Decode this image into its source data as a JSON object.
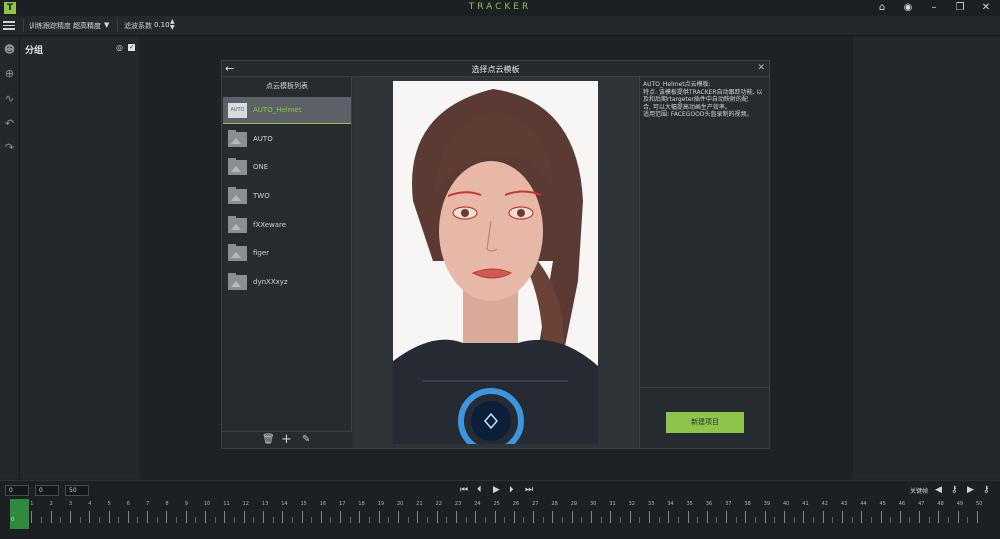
{
  "app": {
    "logo": "T",
    "title": "TRACKER",
    "window_buttons": [
      "home-icon",
      "user-icon",
      "minimize-icon",
      "maximize-icon",
      "close-icon"
    ]
  },
  "toolbar": {
    "precision_label": "训练跟踪精度",
    "precision_value": "超高精度",
    "filter_label": "滤波系数",
    "filter_value": "0.10"
  },
  "left_tools": [
    "face-icon",
    "target-icon",
    "curve-icon",
    "undo-icon",
    "redo-icon"
  ],
  "group_panel": {
    "title": "分组"
  },
  "dialog": {
    "title": "选择点云模板",
    "list_title": "点云模板列表",
    "templates": [
      {
        "name": "AUTO_Helmet",
        "thumb": "AUTO",
        "selected": true
      },
      {
        "name": "AUTO",
        "thumb": "",
        "selected": false
      },
      {
        "name": "ONE",
        "thumb": "",
        "selected": false
      },
      {
        "name": "TWO",
        "thumb": "",
        "selected": false
      },
      {
        "name": "fXXeware",
        "thumb": "",
        "selected": false
      },
      {
        "name": "figer",
        "thumb": "",
        "selected": false
      },
      {
        "name": "dynXXxyz",
        "thumb": "",
        "selected": false
      }
    ],
    "info_lines": [
      "AUTO_Helmet点云模板:",
      "特点: 该模板提供TRACKER自动跟踪功能, 以",
      "及和后期rtargeter插件中自动映射的配",
      "合, 可以大幅提高动画生产效率。",
      "适用范围: FACEGOOD头盔录制的视频。"
    ],
    "new_project_label": "新建项目"
  },
  "timeline": {
    "start": "0",
    "current": "0",
    "end": "50",
    "keyframe_label": "关键帧",
    "ticks": [
      "0",
      "1",
      "2",
      "3",
      "4",
      "5",
      "6",
      "7",
      "8",
      "9",
      "10",
      "11",
      "12",
      "13",
      "14",
      "15",
      "16",
      "17",
      "18",
      "19",
      "20",
      "21",
      "22",
      "23",
      "24",
      "25",
      "26",
      "27",
      "28",
      "29",
      "30",
      "31",
      "32",
      "33",
      "34",
      "35",
      "36",
      "37",
      "38",
      "39",
      "40",
      "41",
      "42",
      "43",
      "44",
      "45",
      "46",
      "47",
      "48",
      "49",
      "50"
    ],
    "playhead_frame": "0"
  },
  "colors": {
    "accent": "#8fc44a",
    "panel": "#23282c",
    "dialog": "#2b3034"
  }
}
